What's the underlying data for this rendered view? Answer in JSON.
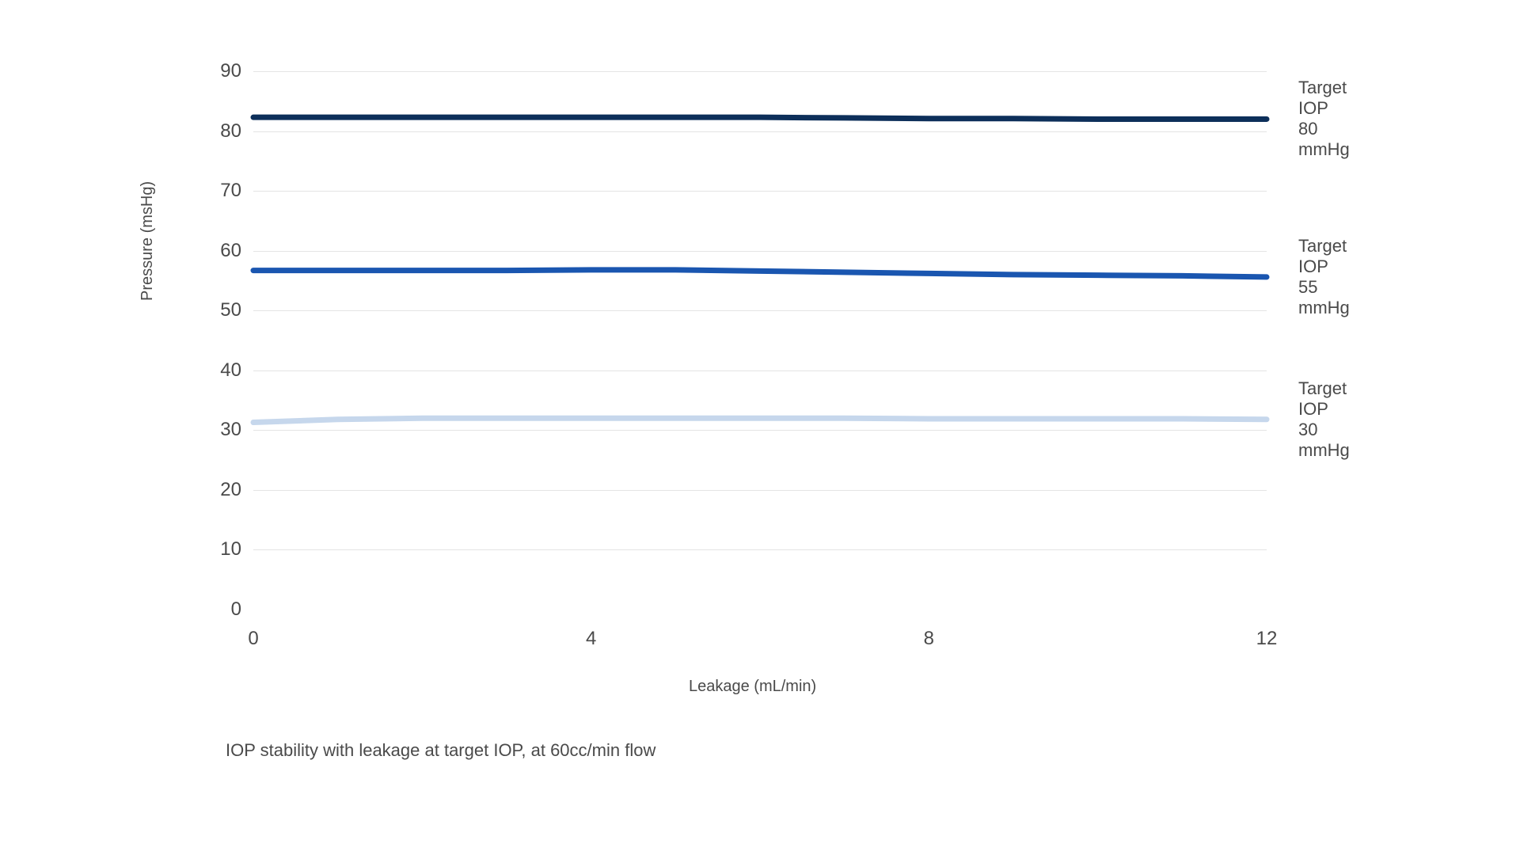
{
  "chart_data": {
    "type": "line",
    "title": "",
    "caption": "IOP stability with leakage at target IOP, at 60cc/min flow",
    "xlabel": "Leakage (mL/min)",
    "ylabel": "Pressure (msHg)",
    "xlim": [
      0,
      12
    ],
    "ylim": [
      0,
      90
    ],
    "xticks": [
      0,
      4,
      8,
      12
    ],
    "yticks": [
      0,
      10,
      20,
      30,
      40,
      50,
      60,
      70,
      80,
      90
    ],
    "x": [
      0,
      1,
      2,
      3,
      4,
      5,
      6,
      7,
      8,
      9,
      10,
      11,
      12
    ],
    "series": [
      {
        "name": "Target IOP 80 mmHg",
        "label": "Target IOP 80 mmHg",
        "color": "#0d2f5a",
        "values": [
          82.3,
          82.3,
          82.3,
          82.3,
          82.3,
          82.3,
          82.3,
          82.2,
          82.1,
          82.1,
          82.0,
          82.0,
          82.0
        ]
      },
      {
        "name": "Target IOP 55 mmHg",
        "label": "Target IOP 55 mmHg",
        "color": "#1a56b0",
        "values": [
          56.7,
          56.7,
          56.7,
          56.7,
          56.8,
          56.8,
          56.6,
          56.4,
          56.2,
          56.0,
          55.9,
          55.8,
          55.6
        ]
      },
      {
        "name": "Target IOP 30 mmHg",
        "label": "Target IOP 30 mmHg",
        "color": "#c6d7ec",
        "values": [
          31.3,
          31.8,
          32.0,
          32.0,
          32.0,
          32.0,
          32.0,
          32.0,
          31.9,
          31.9,
          31.9,
          31.9,
          31.8
        ]
      }
    ]
  }
}
